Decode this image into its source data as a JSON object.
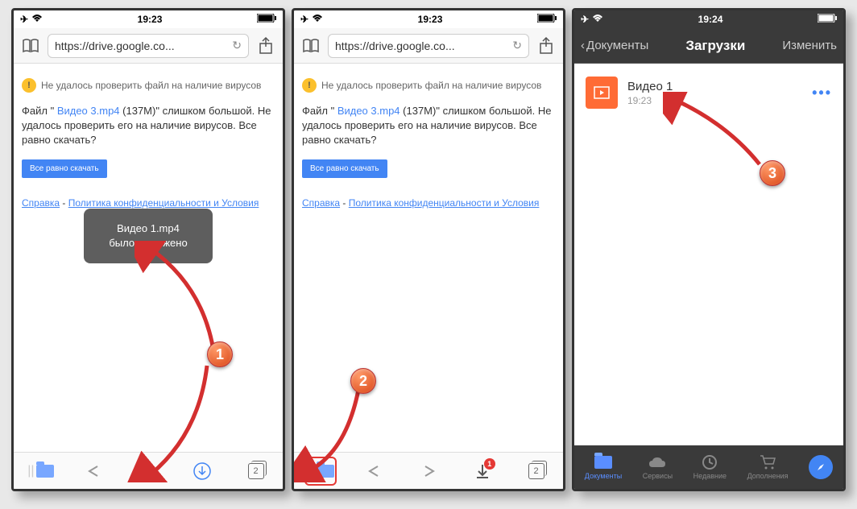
{
  "phone1": {
    "status": {
      "time": "19:23"
    },
    "url": "https://drive.google.co...",
    "warning_header": "Не удалось проверить файл на наличие вирусов",
    "file_text_prefix": "Файл \" ",
    "file_link": "Видео 3.mp4",
    "file_text_suffix": " (137M)\" слишком большой. Не удалось проверить его на наличие вирусов. Все равно скачать?",
    "download_btn": "Все равно скачать",
    "footer_link1": "Справка",
    "footer_sep": " - ",
    "footer_link2": "Политика конфиденциальности и Условия",
    "toast_line1": "Видео 1.mp4",
    "toast_line2": "было загружено",
    "tabs_count": "2",
    "step": "1"
  },
  "phone2": {
    "status": {
      "time": "19:23"
    },
    "url": "https://drive.google.co...",
    "warning_header": "Не удалось проверить файл на наличие вирусов",
    "file_text_prefix": "Файл \" ",
    "file_link": "Видео 3.mp4",
    "file_text_suffix": " (137M)\" слишком большой. Не удалось проверить его на наличие вирусов. Все равно скачать?",
    "download_btn": "Все равно скачать",
    "footer_link1": "Справка",
    "footer_sep": " - ",
    "footer_link2": "Политика конфиденциальности и Условия",
    "badge": "1",
    "tabs_count": "2",
    "step": "2"
  },
  "phone3": {
    "status": {
      "time": "19:24"
    },
    "nav_back": "Документы",
    "nav_title": "Загрузки",
    "nav_edit": "Изменить",
    "file": {
      "name": "Видео 1",
      "time": "19:23"
    },
    "tabs": {
      "t1": "Документы",
      "t2": "Сервисы",
      "t3": "Недавние",
      "t4": "Дополнения"
    },
    "step": "3"
  }
}
